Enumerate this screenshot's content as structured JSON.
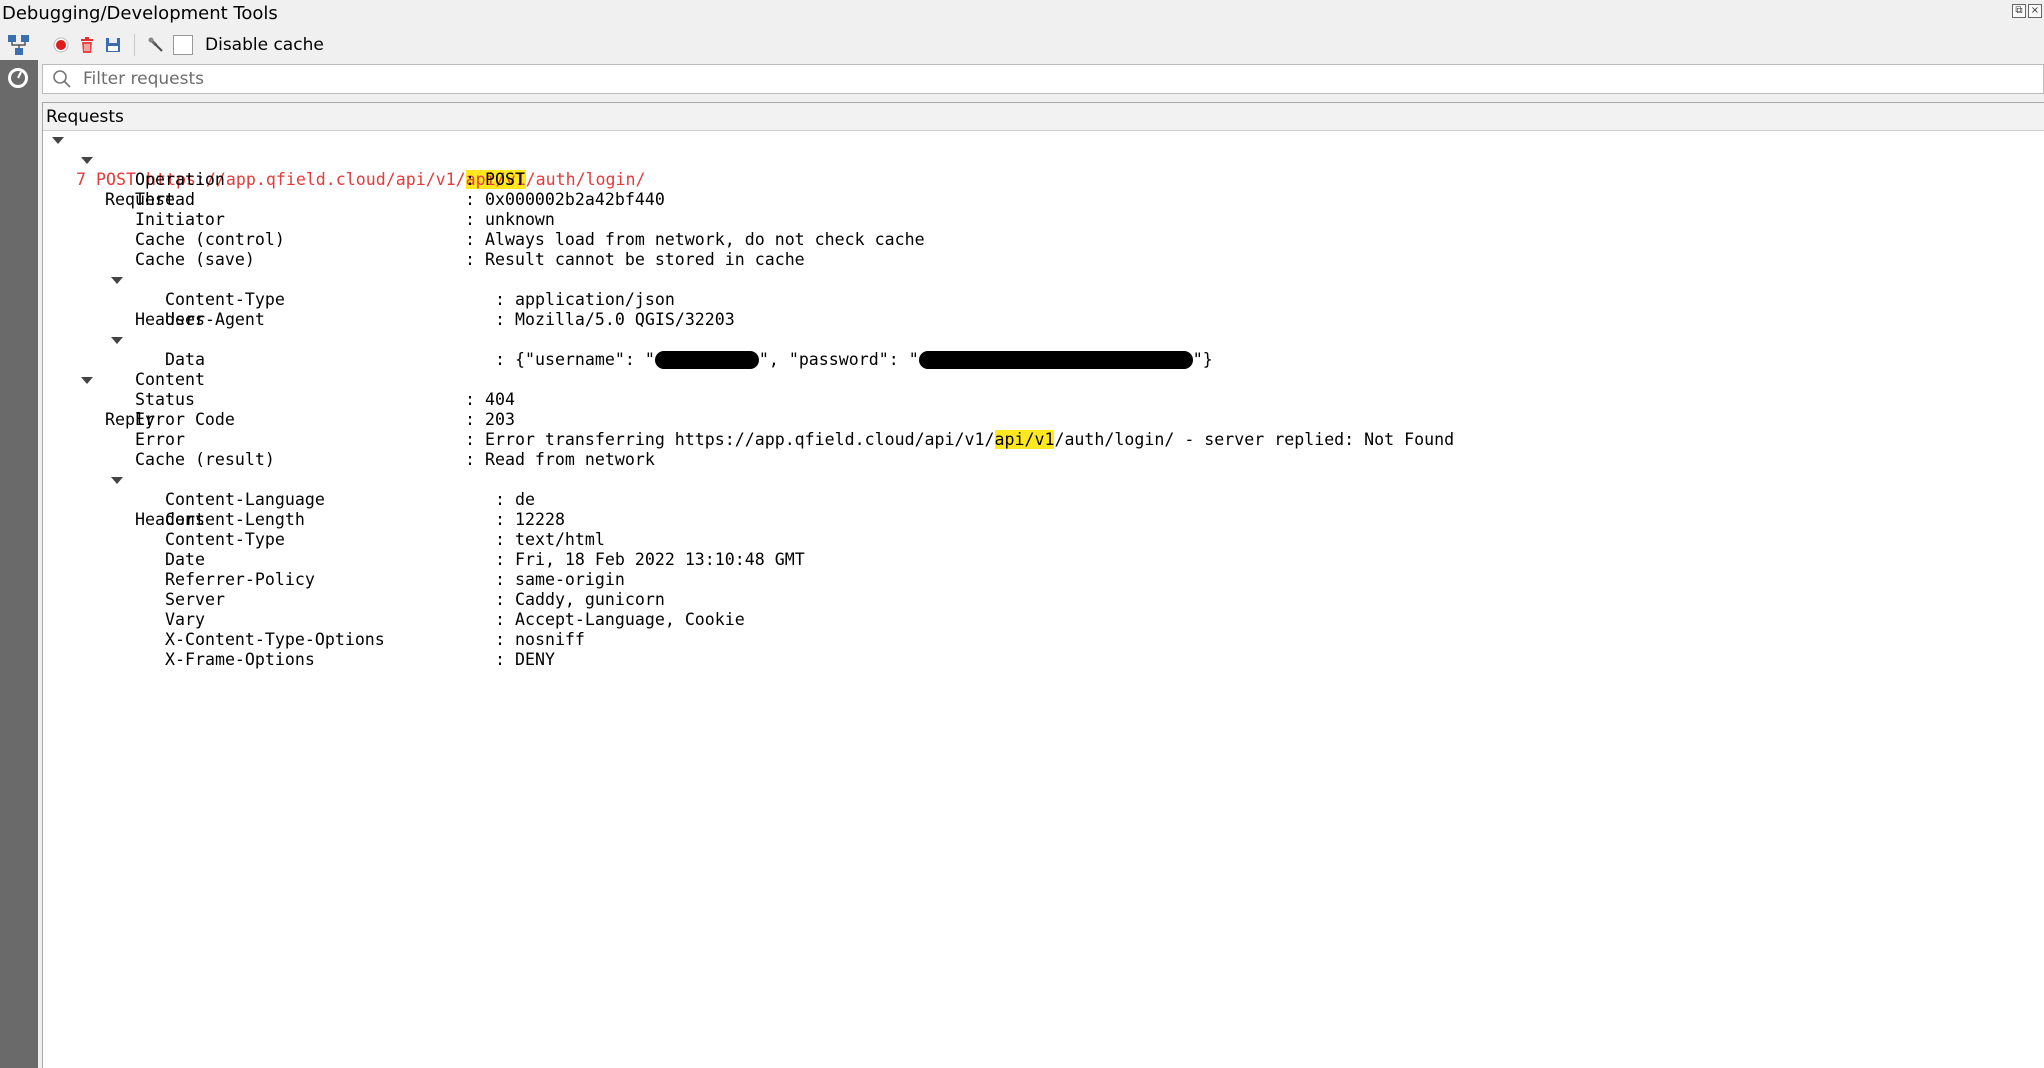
{
  "window": {
    "title": "Debugging/Development Tools"
  },
  "toolbar": {
    "icons": [
      "network-icon",
      "record-icon",
      "clear-icon",
      "save-icon",
      "settings-icon"
    ],
    "disable_cache_label": "Disable cache",
    "disable_cache_checked": false
  },
  "filter": {
    "placeholder": "Filter requests",
    "value": ""
  },
  "panel": {
    "header": "Requests"
  },
  "request": {
    "id": "7",
    "method": "POST",
    "url_prefix": "https://app.qfield.cloud/api/v1/",
    "url_highlight": "api/v1",
    "url_suffix": "/auth/login/",
    "request_section": {
      "label": "Request",
      "fields": [
        {
          "key": "Operation",
          "value": "POST"
        },
        {
          "key": "Thread",
          "value": "0x000002b2a42bf440"
        },
        {
          "key": "Initiator",
          "value": "unknown"
        },
        {
          "key": "Cache (control)",
          "value": "Always load from network, do not check cache"
        },
        {
          "key": "Cache (save)",
          "value": "Result cannot be stored in cache"
        }
      ],
      "headers_label": "Headers",
      "headers": [
        {
          "key": "Content-Type",
          "value": "application/json"
        },
        {
          "key": "User-Agent",
          "value": "Mozilla/5.0 QGIS/32203"
        }
      ],
      "content_label": "Content",
      "content": {
        "key": "Data",
        "part1": "{\"username\": \"",
        "part2": "\", \"password\": \"",
        "part3": "\"}"
      }
    },
    "reply_section": {
      "label": "Reply",
      "fields": [
        {
          "key": "Status",
          "value": "404"
        },
        {
          "key": "Error Code",
          "value": "203"
        }
      ],
      "error": {
        "key": "Error",
        "prefix": "Error transferring https://app.qfield.cloud/api/v1/",
        "highlight": "api/v1",
        "suffix": "/auth/login/ - server replied: Not Found"
      },
      "cache_result": {
        "key": "Cache (result)",
        "value": "Read from network"
      },
      "headers_label": "Headers",
      "headers": [
        {
          "key": "Content-Language",
          "value": "de"
        },
        {
          "key": "Content-Length",
          "value": "12228"
        },
        {
          "key": "Content-Type",
          "value": "text/html"
        },
        {
          "key": "Date",
          "value": "Fri, 18 Feb 2022 13:10:48 GMT"
        },
        {
          "key": "Referrer-Policy",
          "value": "same-origin"
        },
        {
          "key": "Server",
          "value": "Caddy, gunicorn"
        },
        {
          "key": "Vary",
          "value": "Accept-Language, Cookie"
        },
        {
          "key": "X-Content-Type-Options",
          "value": "nosniff"
        },
        {
          "key": "X-Frame-Options",
          "value": "DENY"
        }
      ]
    }
  },
  "colors": {
    "request_title": "#e53b3b",
    "highlight": "#ffe81f",
    "sidebar_dark": "#6a6a6a"
  }
}
